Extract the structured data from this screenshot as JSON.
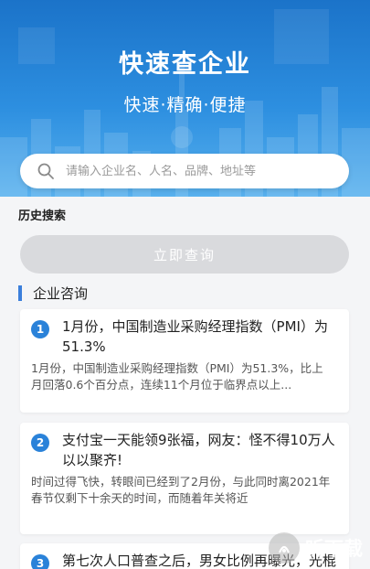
{
  "header": {
    "title": "快速查企业",
    "slogan": "快速·精确·便捷"
  },
  "search": {
    "placeholder": "请输入企业名、人名、品牌、地址等",
    "value": "",
    "icon": "search-icon"
  },
  "history": {
    "label": "历史搜索"
  },
  "submit": {
    "label": "立即查询"
  },
  "news": {
    "section_title": "企业咨询",
    "items": [
      {
        "index": "1",
        "title": "1月份，中国制造业采购经理指数（PMI）为51.3%",
        "summary": "1月份，中国制造业采购经理指数（PMI）为51.3%，比上月回落0.6个百分点，连续11个月位于临界点以上..."
      },
      {
        "index": "2",
        "title": "支付宝一天能领9张福，网友：怪不得10万人以以聚齐!",
        "summary": "时间过得飞快，转眼间已经到了2月份，与此同时离2021年春节仅剩下十余天的时间，而随着年关将近"
      },
      {
        "index": "3",
        "title": "第七次人口普查之后，男女比例再曝光，光棍数量五..."
      }
    ]
  },
  "watermark": {
    "text": "听下载"
  },
  "colors": {
    "hero_top": "#1b73c9",
    "accent": "#2a82d9",
    "button_disabled": "#d9dadd"
  }
}
